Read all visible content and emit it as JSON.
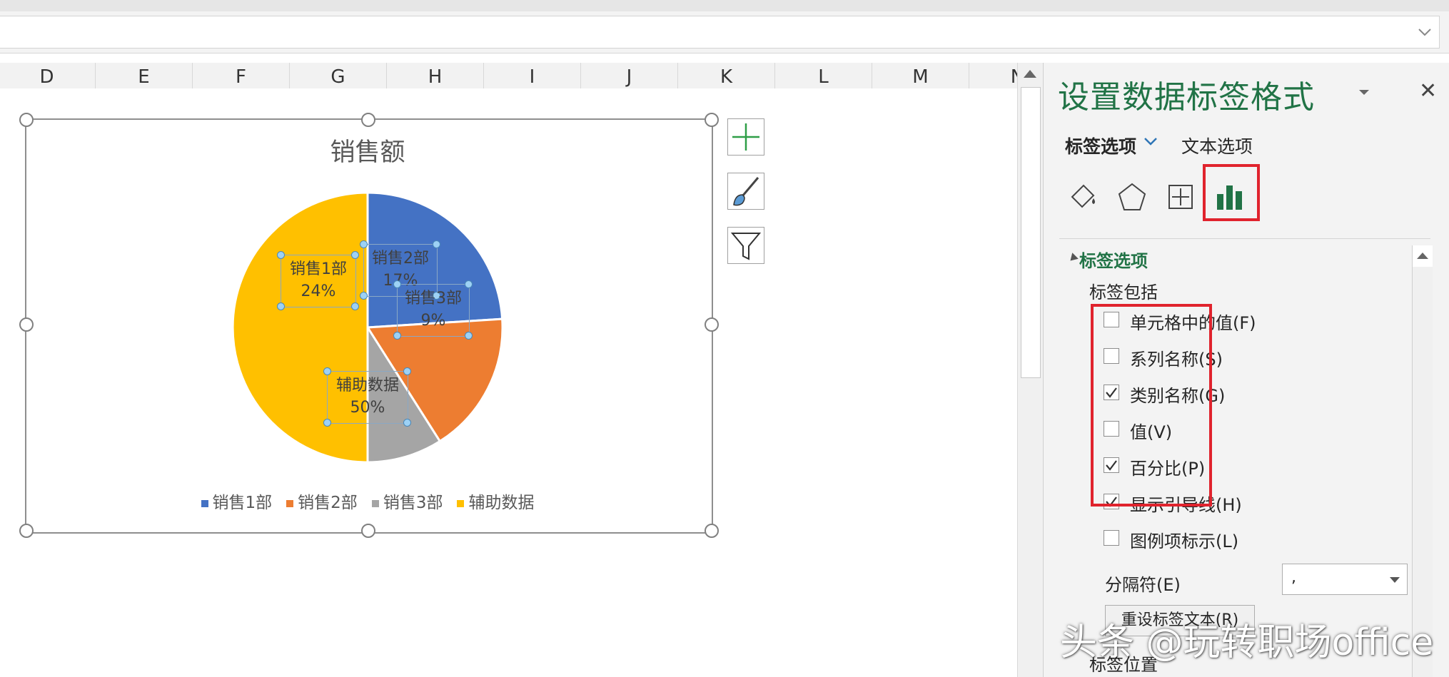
{
  "columns": [
    "D",
    "E",
    "F",
    "G",
    "H",
    "I",
    "J",
    "K",
    "L",
    "M",
    "N"
  ],
  "chart_data": {
    "type": "pie",
    "title": "销售额",
    "categories": [
      "销售1部",
      "销售2部",
      "销售3部",
      "辅助数据"
    ],
    "values": [
      24,
      17,
      9,
      50
    ],
    "value_unit": "%",
    "colors": [
      "#4472c4",
      "#ed7d31",
      "#a5a5a5",
      "#ffc000"
    ],
    "data_labels": [
      {
        "category": "销售1部",
        "percent": "24%"
      },
      {
        "category": "销售2部",
        "percent": "17%"
      },
      {
        "category": "销售3部",
        "percent": "9%"
      },
      {
        "category": "辅助数据",
        "percent": "50%"
      }
    ],
    "legend_position": "bottom"
  },
  "chart_buttons": [
    {
      "icon": "plus-icon",
      "label": "chart-elements"
    },
    {
      "icon": "brush-icon",
      "label": "chart-styles"
    },
    {
      "icon": "filter-icon",
      "label": "chart-filters"
    }
  ],
  "pane": {
    "title": "设置数据标签格式",
    "tabs": {
      "label_options": "标签选项",
      "text_options": "文本选项"
    },
    "section_header": "标签选项",
    "label_contains": "标签包括",
    "checkboxes": [
      {
        "label": "单元格中的值(F)",
        "checked": false
      },
      {
        "label": "系列名称(S)",
        "checked": false
      },
      {
        "label": "类别名称(G)",
        "checked": true
      },
      {
        "label": "值(V)",
        "checked": false
      },
      {
        "label": "百分比(P)",
        "checked": true
      },
      {
        "label": "显示引导线(H)",
        "checked": true
      },
      {
        "label": "图例项标示(L)",
        "checked": false
      }
    ],
    "separator_label": "分隔符(E)",
    "separator_value": ",",
    "reset_button": "重设标签文本(R)",
    "label_position": "标签位置"
  },
  "watermark": "头条 @玩转职场office"
}
